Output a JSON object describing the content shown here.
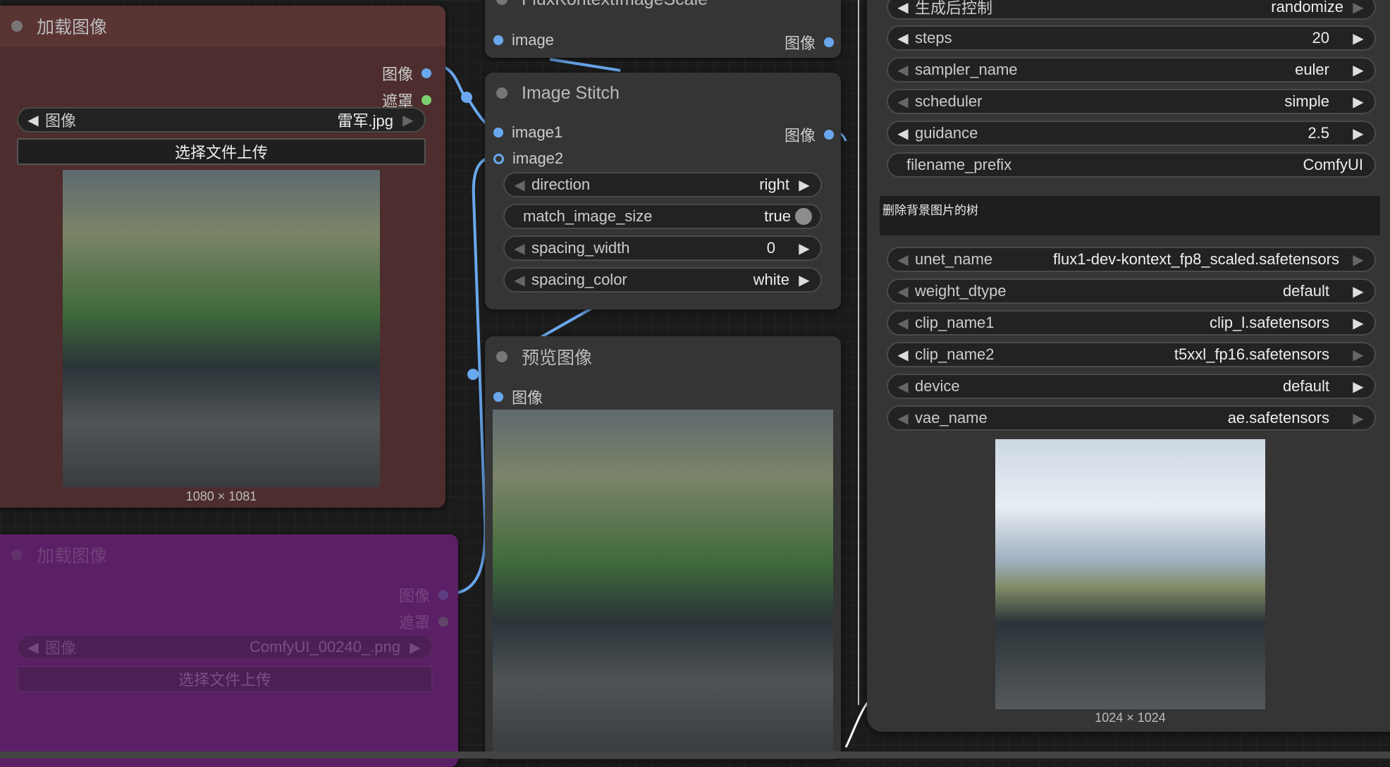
{
  "colors": {
    "canvas": "#1b1b1b",
    "node_body": "#353535",
    "load_node_body": "#4d2d2d",
    "load_node_title": "#5a3333",
    "bypassed_node": "#5b1f66",
    "link_blue": "#6aa8ee",
    "mask_green": "#7ccf70"
  },
  "load_image_1": {
    "title": "加载图像",
    "outputs": [
      "图像",
      "遮罩"
    ],
    "image_widget": {
      "label": "图像",
      "value": "雷军.jpg"
    },
    "upload_button": "选择文件上传",
    "dimensions": "1080 × 1081"
  },
  "load_image_2": {
    "title": "加载图像",
    "outputs": [
      "图像",
      "遮罩"
    ],
    "image_widget": {
      "label": "图像",
      "value": "ComfyUI_00240_.png"
    },
    "upload_button": "选择文件上传"
  },
  "flux_scale": {
    "title": "FluxKontextImageScale",
    "input": "image",
    "output": "图像"
  },
  "image_stitch": {
    "title": "Image Stitch",
    "inputs": [
      "image1",
      "image2"
    ],
    "output": "图像",
    "widgets": [
      {
        "label": "direction",
        "value": "right"
      },
      {
        "label": "match_image_size",
        "value": "true"
      },
      {
        "label": "spacing_width",
        "value": "0"
      },
      {
        "label": "spacing_color",
        "value": "white"
      }
    ]
  },
  "preview": {
    "title": "预览图像",
    "input": "图像"
  },
  "sampler": {
    "widgets": [
      {
        "label": "生成后控制",
        "value": "randomize"
      },
      {
        "label": "steps",
        "value": "20"
      },
      {
        "label": "sampler_name",
        "value": "euler"
      },
      {
        "label": "scheduler",
        "value": "simple"
      },
      {
        "label": "guidance",
        "value": "2.5"
      },
      {
        "label": "filename_prefix",
        "value": "ComfyUI"
      }
    ],
    "prompt": "删除背景图片的树"
  },
  "loaders": {
    "widgets": [
      {
        "label": "unet_name",
        "value": "flux1-dev-kontext_fp8_scaled.safetensors"
      },
      {
        "label": "weight_dtype",
        "value": "default"
      },
      {
        "label": "clip_name1",
        "value": "clip_l.safetensors"
      },
      {
        "label": "clip_name2",
        "value": "t5xxl_fp16.safetensors"
      },
      {
        "label": "device",
        "value": "default"
      },
      {
        "label": "vae_name",
        "value": "ae.safetensors"
      }
    ],
    "output_dimensions": "1024 × 1024"
  }
}
